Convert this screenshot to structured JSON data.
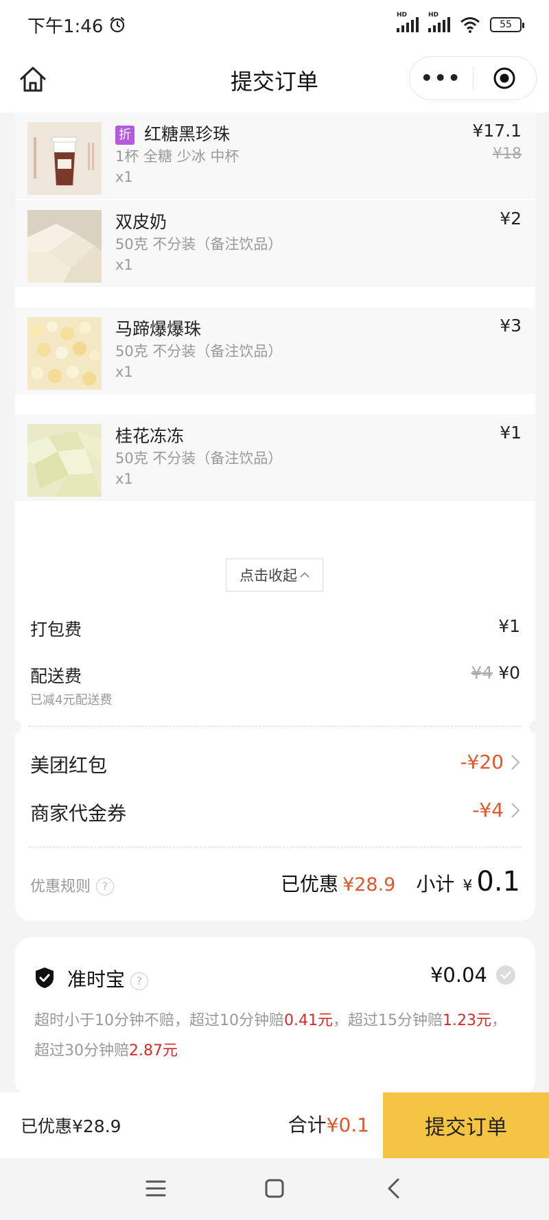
{
  "status_bar": {
    "time": "下午1:46",
    "network_1": "HD",
    "network_2": "HD",
    "battery": "55"
  },
  "nav": {
    "title": "提交订单",
    "more_label": "•••"
  },
  "items": [
    {
      "tag": "折",
      "name": "红糖黑珍珠",
      "spec": "1杯 全糖 少冰 中杯",
      "qty": "x1",
      "price": "¥17.1",
      "original_price": "¥18",
      "thumb_text": "红糖黑珍珠"
    },
    {
      "name": "双皮奶",
      "spec": "50克 不分装（备注饮品）",
      "qty": "x1",
      "price": "¥2"
    },
    {
      "name": "马蹄爆爆珠",
      "spec": "50克 不分装（备注饮品）",
      "qty": "x1",
      "price": "¥3"
    },
    {
      "name": "桂花冻冻",
      "spec": "50克 不分装（备注饮品）",
      "qty": "x1",
      "price": "¥1"
    }
  ],
  "collapse_label": "点击收起",
  "fees": {
    "packing_label": "打包费",
    "packing_value": "¥1",
    "delivery_label": "配送费",
    "delivery_original": "¥4",
    "delivery_value": "¥0",
    "delivery_note": "已减4元配送费"
  },
  "promos": [
    {
      "label": "美团红包",
      "value": "-¥20"
    },
    {
      "label": "商家代金券",
      "value": "-¥4"
    }
  ],
  "summary": {
    "rules_label": "优惠规则",
    "discount_label": "已优惠",
    "discount_value": "¥28.9",
    "subtotal_label": "小计",
    "subtotal_currency": "¥",
    "subtotal_value": "0.1"
  },
  "insurance": {
    "title": "准时宝",
    "price": "¥0.04",
    "desc_1": "超时小于10分钟不赔，超过10分钟赔",
    "amount_1": "0.41元",
    "desc_2": "，超过15分钟赔",
    "amount_2": "1.23元",
    "desc_3": "，超过30分钟赔",
    "amount_3": "2.87元"
  },
  "bottom": {
    "discount_text": "已优惠¥28.9",
    "total_label": "合计",
    "total_value": "¥0.1",
    "submit_label": "提交订单"
  },
  "colors": {
    "accent_orange": "#e1562a",
    "accent_red": "#d32b2b",
    "submit_yellow": "#f5c443",
    "tag_purple": "#b65ad9"
  }
}
